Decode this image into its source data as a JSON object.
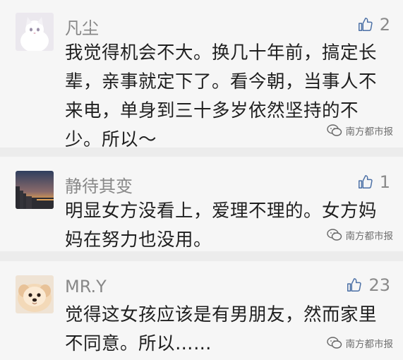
{
  "comments": [
    {
      "username": "凡尘",
      "likes": "2",
      "text": "我觉得机会不大。换几十年前，搞定长辈，亲事就定下了。看今朝，当事人不来电，单身到三十多岁依然坚持的不少。所以～",
      "watermark": "南方都市报",
      "avatar_colors": [
        "#e9e6ec",
        "#c9c4cf"
      ]
    },
    {
      "username": "静待其变",
      "likes": "1",
      "text": "明显女方没看上，爱理不理的。女方妈妈在努力也没用。",
      "watermark": "南方都市报",
      "avatar_colors": [
        "#3a4a66",
        "#c98a4a"
      ]
    },
    {
      "username": "MR.Y",
      "likes": "23",
      "text": "觉得这女孩应该是有男朋友，然而家里不同意。所以……",
      "watermark": "南方都市报",
      "avatar_colors": [
        "#f1dcc2",
        "#d8a878"
      ]
    }
  ],
  "icons": {
    "like": "thumbs-up-icon",
    "watermark": "wechat-logo-icon"
  },
  "colors": {
    "card_bg": "#f6f6f6",
    "gap_bg": "#ececec",
    "username": "#888888",
    "text": "#1f1f1f",
    "like": "#8a8a8a"
  }
}
